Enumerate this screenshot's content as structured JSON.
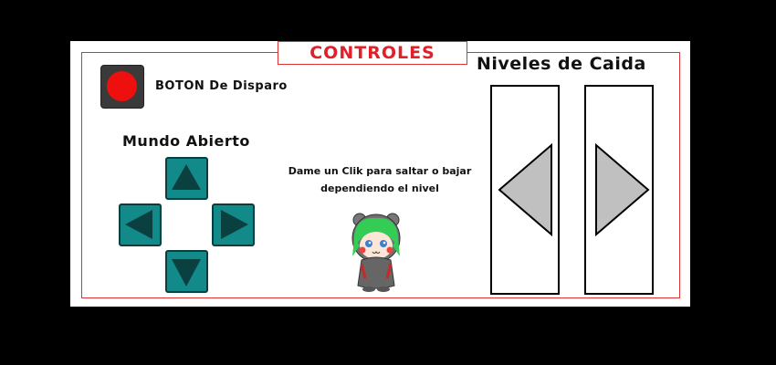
{
  "title": "CONTROLES",
  "fire": {
    "label": "BOTON De Disparo",
    "icon": "red-circle-button-icon",
    "color": "#ee0f0f"
  },
  "movement": {
    "label": "Mundo Abierto",
    "buttons": [
      "up",
      "left",
      "right",
      "down"
    ],
    "color": "#138a8a"
  },
  "hint": {
    "line1": "Dame un Clik para saltar o bajar",
    "line2": "dependiendo el nivel"
  },
  "levels": {
    "label": "Niveles de Caida",
    "buttons": [
      "left",
      "right"
    ],
    "arrow_color": "#c0c0c0"
  },
  "colors": {
    "accent": "#e0202a",
    "border": "#d33",
    "dpad": "#138a8a"
  }
}
